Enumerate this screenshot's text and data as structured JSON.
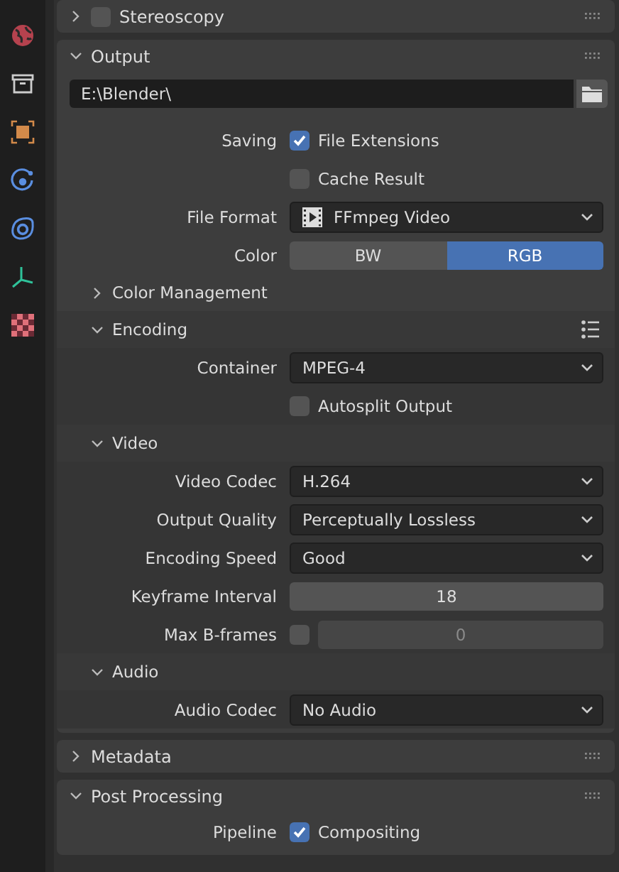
{
  "sidebar": [
    {
      "kind": "world"
    },
    {
      "kind": "output"
    },
    {
      "kind": "object"
    },
    {
      "kind": "physics"
    },
    {
      "kind": "constraints"
    },
    {
      "kind": "data"
    },
    {
      "kind": "texture"
    }
  ],
  "panels": [
    {
      "title": "Stereoscopy",
      "expanded": false,
      "checkbox": false
    },
    {
      "title": "Output",
      "expanded": true,
      "items": [
        {
          "kind": "path",
          "value": "E:\\Blender\\"
        },
        {
          "kind": "checkbox",
          "label": "Saving",
          "text": "File Extensions",
          "checked": true
        },
        {
          "kind": "checkbox",
          "text": "Cache Result",
          "checked": false
        },
        {
          "kind": "dropdown",
          "label": "File Format",
          "value": "FFmpeg Video",
          "film_icon": true
        },
        {
          "kind": "toggle",
          "label": "Color",
          "options": [
            {
              "label": "BW",
              "selected": false
            },
            {
              "label": "RGB",
              "selected": true
            }
          ]
        },
        {
          "kind": "subpanel",
          "title": "Color Management",
          "expanded": false
        },
        {
          "kind": "subpanel",
          "title": "Encoding",
          "expanded": true,
          "presets": true,
          "items": [
            {
              "kind": "dropdown",
              "label": "Container",
              "value": "MPEG-4"
            },
            {
              "kind": "checkbox",
              "text": "Autosplit Output",
              "checked": false
            }
          ]
        },
        {
          "kind": "subpanel",
          "title": "Video",
          "expanded": true,
          "items": [
            {
              "kind": "dropdown",
              "label": "Video Codec",
              "value": "H.264"
            },
            {
              "kind": "dropdown",
              "label": "Output Quality",
              "value": "Perceptually Lossless"
            },
            {
              "kind": "dropdown",
              "label": "Encoding Speed",
              "value": "Good"
            },
            {
              "kind": "number",
              "label": "Keyframe Interval",
              "value": "18"
            },
            {
              "kind": "checknumber",
              "label": "Max B-frames",
              "checked": false,
              "value": "0"
            }
          ]
        },
        {
          "kind": "subpanel",
          "title": "Audio",
          "expanded": true,
          "items": [
            {
              "kind": "dropdown",
              "label": "Audio Codec",
              "value": "No Audio"
            }
          ]
        }
      ]
    },
    {
      "title": "Metadata",
      "expanded": false
    },
    {
      "title": "Post Processing",
      "expanded": true,
      "items": [
        {
          "kind": "checkbox",
          "label": "Pipeline",
          "text": "Compositing",
          "checked": true
        }
      ]
    }
  ]
}
